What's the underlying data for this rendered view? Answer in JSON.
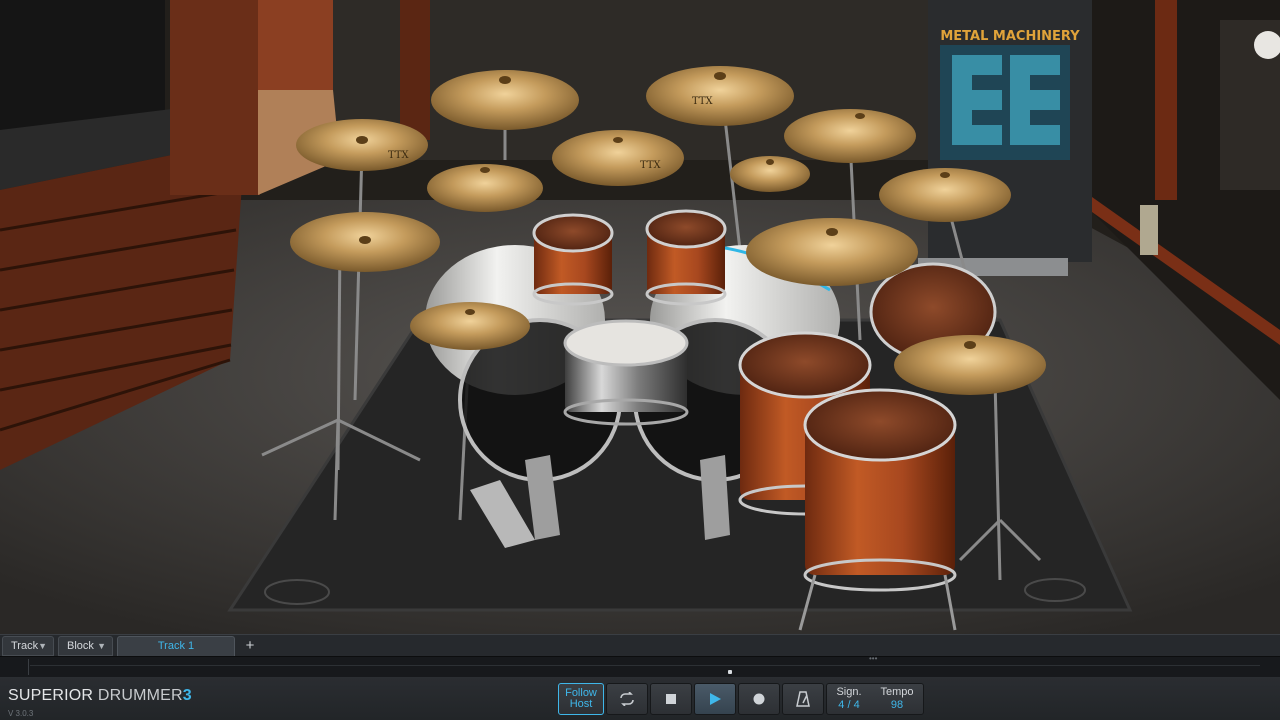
{
  "app": {
    "name_part1": "SUPERIOR",
    "name_part2": " DRUMMER",
    "name_num": "3",
    "version": "V 3.0.3"
  },
  "stage": {
    "banner_title": "METAL MACHINERY",
    "cymbal_brand": "TTX"
  },
  "track_bar": {
    "track_dropdown": "Track",
    "block_dropdown": "Block",
    "active_track": "Track 1",
    "add_label": "+"
  },
  "transport": {
    "follow_line1": "Follow",
    "follow_line2": "Host",
    "sign_label": "Sign.",
    "sign_value": "4 / 4",
    "tempo_label": "Tempo",
    "tempo_value": "98"
  },
  "icons": {
    "loop": "loop-icon",
    "stop": "stop-icon",
    "play": "play-icon",
    "record": "record-icon",
    "metronome": "metronome-icon",
    "chevron": "chevron-down-icon"
  },
  "colors": {
    "accent": "#3fb7ea",
    "cymbal": "#c49b5c",
    "wood_shell": "#a8481f",
    "bass_drum_head": "#e8e8e6",
    "rug": "#2a2a2a",
    "banner_text": "#e0a33a"
  }
}
